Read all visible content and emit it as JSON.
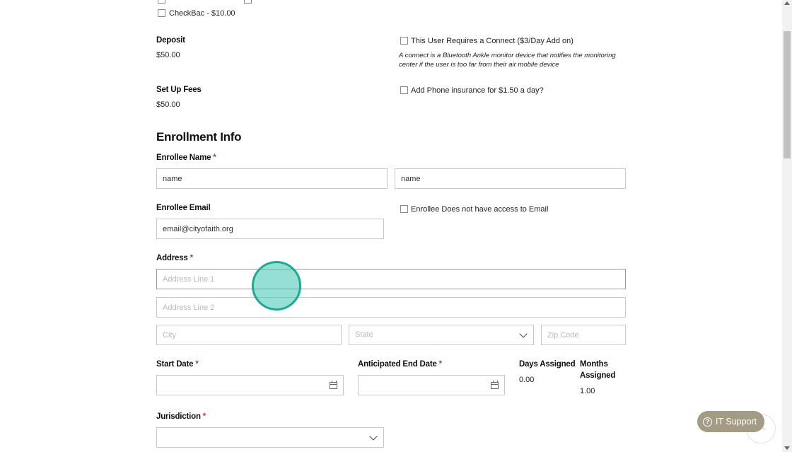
{
  "addons": {
    "checkbac_label": "CheckBac - $10.00",
    "connect_label": "This User Requires a Connect ($3/Day Add on)",
    "connect_note": "A connect is a Bluetooth Ankle monitor device that notifies the monitoring center if the user is too far from their air mobile device",
    "phone_insurance_label": "Add Phone insurance for $1.50 a day?"
  },
  "fees": {
    "deposit_label": "Deposit",
    "deposit_value": "$50.00",
    "setup_label": "Set Up Fees",
    "setup_value": "$50.00"
  },
  "enrollment": {
    "title": "Enrollment Info",
    "name_label": "Enrollee Name",
    "first_name_value": "name",
    "last_name_value": "name",
    "email_label": "Enrollee Email",
    "email_value": "email@cityofaith.org",
    "no_email_label": "Enrollee Does not have access to Email",
    "address_label": "Address",
    "address1_placeholder": "Address Line 1",
    "address2_placeholder": "Address Line 2",
    "city_placeholder": "City",
    "state_placeholder": "State",
    "zip_placeholder": "Zip Code",
    "start_date_label": "Start Date",
    "end_date_label": "Anticipated End Date",
    "days_assigned_label": "Days Assigned",
    "days_assigned_value": "0.00",
    "months_assigned_label_1": "Months",
    "months_assigned_label_2": "Assigned",
    "months_assigned_value": "1.00",
    "jurisdiction_label": "Jurisdiction",
    "required_mark": "*"
  },
  "support": {
    "button_label": "IT Support",
    "icon": "?"
  }
}
